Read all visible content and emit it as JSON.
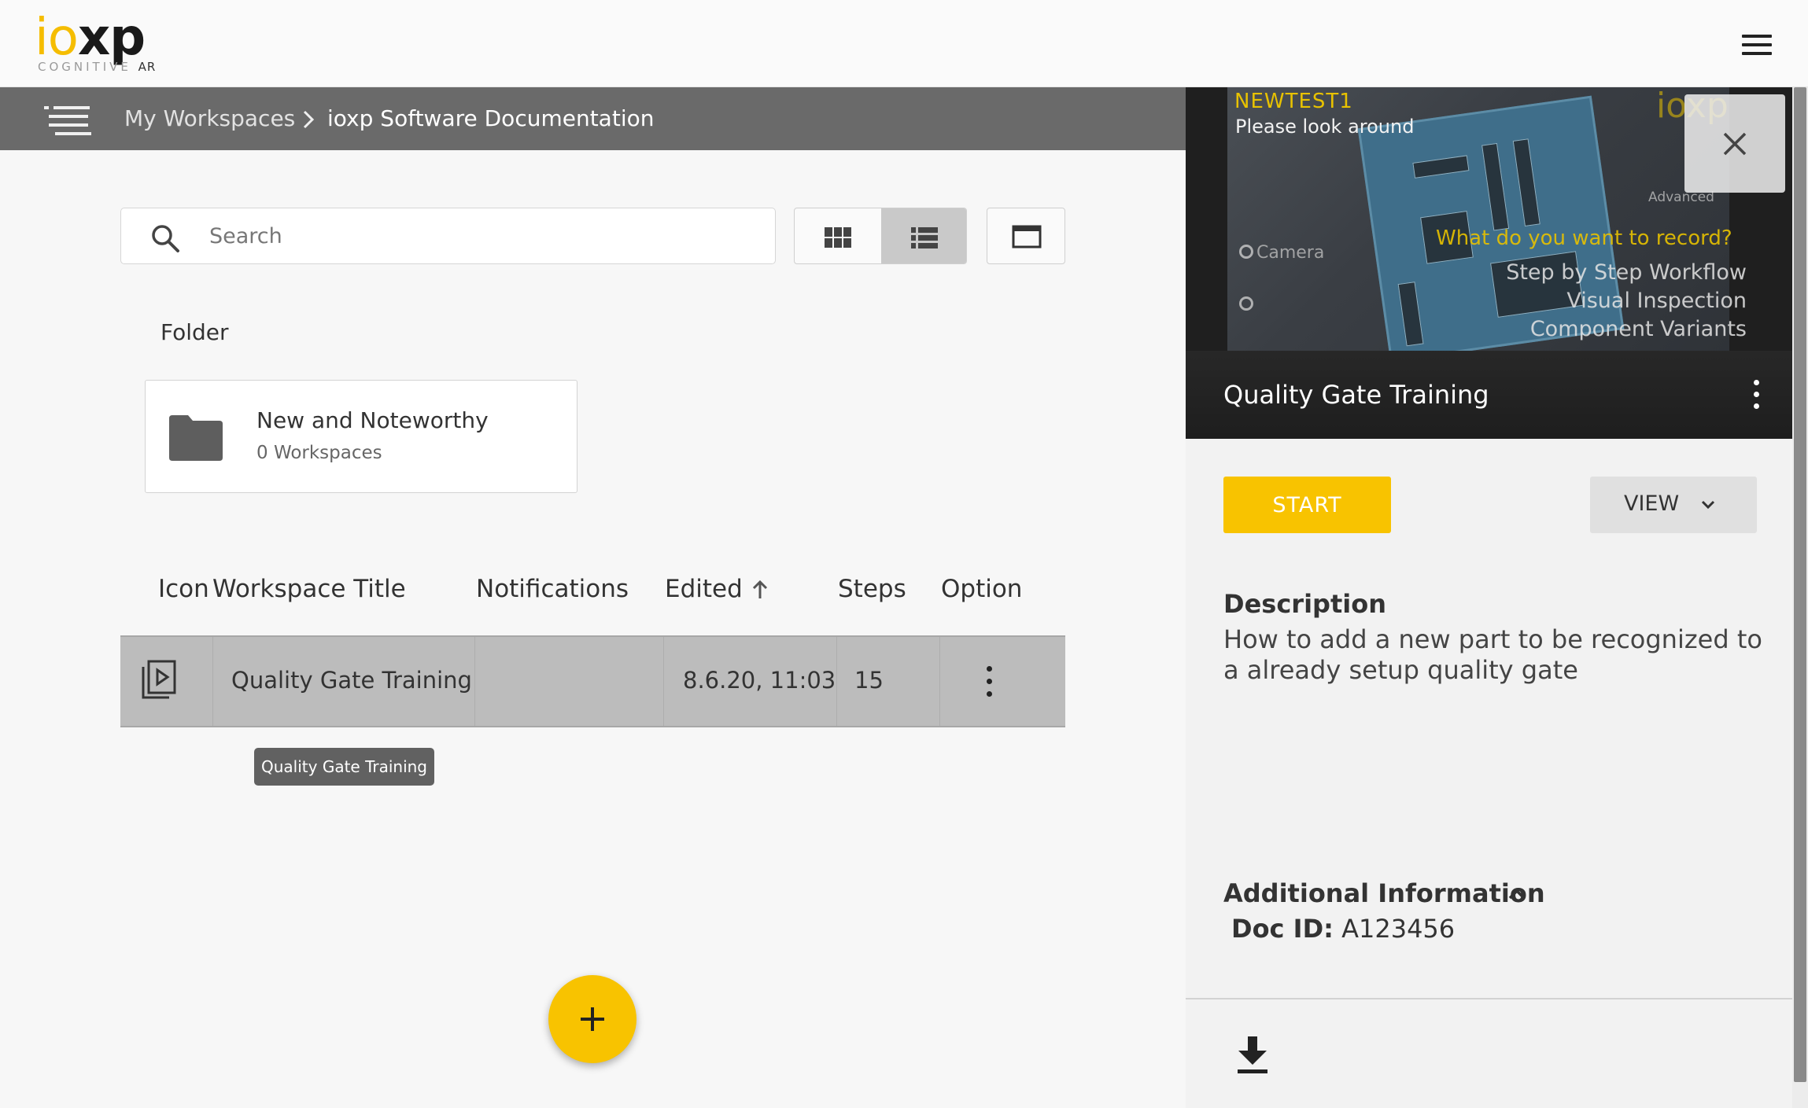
{
  "app": {
    "logo_text": "ioxp",
    "logo_tagline": "COGNITIVE AR",
    "brand_yellow": "#F8C300",
    "menu_icon": "hamburger-menu-icon"
  },
  "breadcrumb": {
    "items": [
      "My Workspaces",
      "ioxp Software Documentation"
    ]
  },
  "search": {
    "placeholder": "Search",
    "value": ""
  },
  "view_toggle": {
    "options": [
      "grid-view-icon",
      "list-view-icon"
    ],
    "selected": "list"
  },
  "folders": {
    "heading": "Folder",
    "items": [
      {
        "name": "New and Noteworthy",
        "count": "0 Workspaces"
      }
    ]
  },
  "table": {
    "columns": [
      "Icon",
      "Workspace Title",
      "Notifications",
      "Edited",
      "Steps",
      "Option"
    ],
    "sort": {
      "column": "Edited",
      "direction": "ascending"
    },
    "rows": [
      {
        "icon": "play-document-icon",
        "title": "Quality Gate Training",
        "notifications": "",
        "edited": "8.6.20, 11:03",
        "steps": "15"
      }
    ]
  },
  "tooltip": "Quality Gate Training",
  "detail": {
    "title": "Quality Gate Training",
    "preview_overlay": {
      "tag": "NEWTEST1",
      "prompt": "Please look around",
      "watermark": "ioxp",
      "advanced": "Advanced",
      "camera": "Camera",
      "question": "What do you want to record?",
      "menu": [
        "Step by Step Workflow",
        "Visual Inspection",
        "Component Variants"
      ]
    },
    "start_label": "START",
    "view_label": "VIEW",
    "description_heading": "Description",
    "description": "How to add a new part to be recognized to a already setup quality gate",
    "additional_heading": "Additional Information",
    "doc_id_label": "Doc ID:",
    "doc_id_value": "A123456"
  }
}
